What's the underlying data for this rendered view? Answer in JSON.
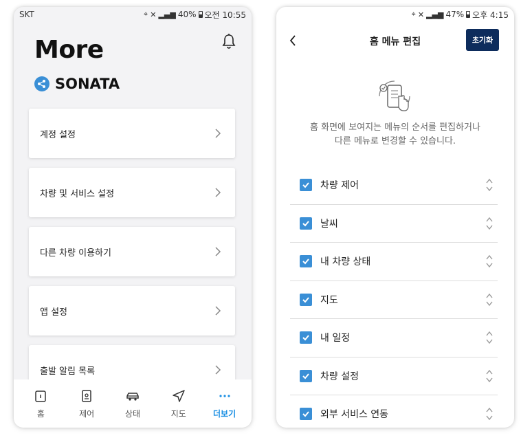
{
  "left": {
    "status": {
      "carrier": "SKT",
      "battery": "40%",
      "time": "오전 10:55"
    },
    "title": "More",
    "car_name": "SONATA",
    "menu": [
      {
        "label": "계정 설정"
      },
      {
        "label": "차량 및 서비스 설정"
      },
      {
        "label": "다른 차량 이용하기"
      },
      {
        "label": "앱 설정"
      },
      {
        "label": "출발 알림 목록"
      }
    ],
    "nav": [
      {
        "label": "홈",
        "icon": "home-icon"
      },
      {
        "label": "제어",
        "icon": "control-icon"
      },
      {
        "label": "상태",
        "icon": "car-icon"
      },
      {
        "label": "지도",
        "icon": "navigation-icon"
      },
      {
        "label": "더보기",
        "icon": "more-icon",
        "active": true
      }
    ],
    "accent": "#1a8fe3"
  },
  "right": {
    "status": {
      "battery": "47%",
      "time": "오후 4:15"
    },
    "title": "홈 메뉴 편집",
    "reset_label": "초기화",
    "description_line1": "홈 화면에 보여지는 메뉴의 순서를 편집하거나",
    "description_line2": "다른 메뉴로 변경할 수 있습니다.",
    "items": [
      {
        "label": "차량 제어",
        "checked": true
      },
      {
        "label": "날씨",
        "checked": true
      },
      {
        "label": "내 차량 상태",
        "checked": true
      },
      {
        "label": "지도",
        "checked": true
      },
      {
        "label": "내 일정",
        "checked": true
      },
      {
        "label": "차량 설정",
        "checked": true
      },
      {
        "label": "외부 서비스 연동",
        "checked": true
      }
    ],
    "button_color": "#0d2c5c",
    "check_color": "#3a8fd6"
  }
}
